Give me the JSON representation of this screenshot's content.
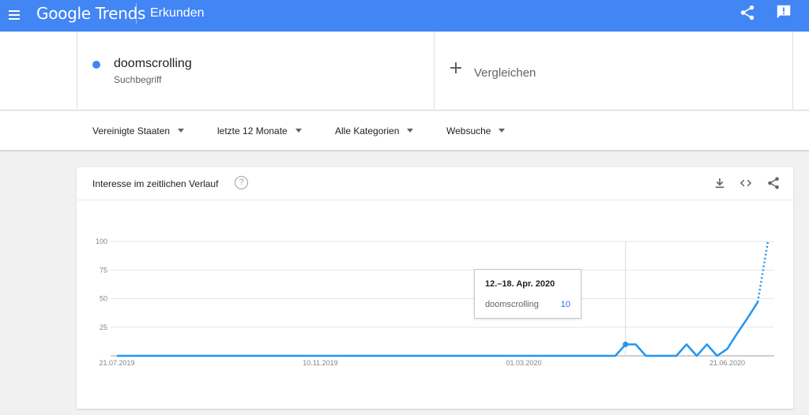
{
  "topbar": {
    "brand": "Google Trends",
    "section": "Erkunden"
  },
  "search": {
    "term": "doomscrolling",
    "term_type": "Suchbegriff",
    "term_color": "#4285f4",
    "compare_label": "Vergleichen"
  },
  "filters": {
    "region": "Vereinigte Staaten",
    "period": "letzte 12 Monate",
    "category": "Alle Kategorien",
    "search_type": "Websuche"
  },
  "card": {
    "title": "Interesse im zeitlichen Verlauf",
    "help_glyph": "?"
  },
  "tooltip": {
    "date": "12.–18. Apr. 2020",
    "term": "doomscrolling",
    "value": "10"
  },
  "colors": {
    "brand": "#4285f4",
    "series": "#2196f3",
    "grid": "#e6e6e6"
  },
  "icons": {
    "menu": "menu-icon",
    "share": "share-icon",
    "feedback": "feedback-icon",
    "download": "download-icon",
    "embed": "embed-icon",
    "help": "help-icon"
  },
  "chart_data": {
    "type": "line",
    "ylim": [
      0,
      100
    ],
    "y_ticks": [
      25,
      50,
      75,
      100
    ],
    "x_ticks": [
      "21.07.2019",
      "10.11.2019",
      "01.03.2020",
      "21.06.2020"
    ],
    "series": [
      {
        "name": "doomscrolling",
        "values": [
          0,
          0,
          0,
          0,
          0,
          0,
          0,
          0,
          0,
          0,
          0,
          0,
          0,
          0,
          0,
          0,
          0,
          0,
          0,
          0,
          0,
          0,
          0,
          0,
          0,
          0,
          0,
          0,
          0,
          0,
          0,
          0,
          0,
          0,
          0,
          0,
          0,
          0,
          0,
          0,
          0,
          0,
          0,
          0,
          0,
          0,
          0,
          0,
          0,
          0,
          10,
          10,
          0,
          0,
          0,
          0,
          10,
          0,
          10,
          0,
          6,
          20,
          33,
          47,
          100
        ],
        "partial_from_index": 63
      }
    ],
    "highlight_index": 50
  }
}
